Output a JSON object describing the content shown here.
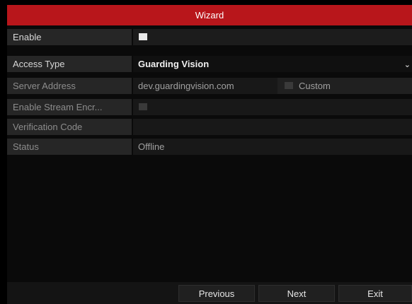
{
  "window": {
    "title": "Wizard"
  },
  "form": {
    "enable": {
      "label": "Enable",
      "checked": true
    },
    "access_type": {
      "label": "Access Type",
      "value": "Guarding Vision"
    },
    "server_address": {
      "label": "Server Address",
      "value": "dev.guardingvision.com",
      "custom_label": "Custom",
      "custom_checked": false
    },
    "stream_encryption": {
      "label": "Enable Stream Encr...",
      "checked": false
    },
    "verification_code": {
      "label": "Verification Code",
      "value": ""
    },
    "status": {
      "label": "Status",
      "value": "Offline"
    }
  },
  "buttons": {
    "previous": "Previous",
    "next": "Next",
    "exit": "Exit"
  },
  "colors": {
    "title_bar": "#b8161b",
    "background": "#000000"
  },
  "icons": {
    "dropdown": "chevron-down-icon"
  }
}
